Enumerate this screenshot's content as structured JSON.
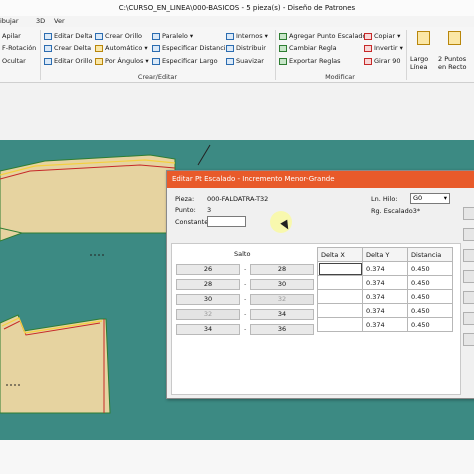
{
  "window": {
    "title": "C:\\CURSO_EN_LINEA\\000-BASICOS  -  5 pieza(s)  -  Diseño de Patrones"
  },
  "menu": {
    "items": [
      "ibujar",
      "3D",
      "Ver"
    ]
  },
  "ribbon": {
    "col1": [
      "Apilar",
      "F-Rotación",
      "Ocultar"
    ],
    "col2": [
      "Editar Delta",
      "Crear Delta",
      "Editar Orillo"
    ],
    "col3": [
      "Crear Orillo",
      "Automático",
      "Por Ángulos"
    ],
    "col4": [
      "Paralelo",
      "Especificar Distancia",
      "Especificar Largo"
    ],
    "col5": [
      "Internos",
      "Distribuir",
      "Suavizar"
    ],
    "col6": [
      "Agregar Punto Escalado",
      "Cambiar Regla",
      "Exportar Reglas"
    ],
    "col7": [
      "Copiar",
      "Invertir",
      "Girar 90"
    ],
    "big1": [
      "Largo",
      "Línea"
    ],
    "big2": [
      "2 Puntos",
      "en Recto"
    ],
    "groups": [
      "Crear/Editar",
      "Modificar"
    ]
  },
  "dialog": {
    "title": "Editar Pt Escalado - Incremento Menor-Grande",
    "pieza_label": "Pieza:",
    "pieza_value": "000-FALDATRA-T32",
    "punto_label": "Punto:",
    "punto_value": "3",
    "constante_label": "Constante:",
    "constante_value": "",
    "lnhilo_label": "Ln. Hilo:",
    "lnhilo_value": "G0",
    "rg_label": "Rg. Escalado3*",
    "salto_label": "Salto",
    "steps": [
      {
        "from": "26",
        "to": "28",
        "from_enabled": true,
        "to_enabled": true
      },
      {
        "from": "28",
        "to": "30",
        "from_enabled": true,
        "to_enabled": true
      },
      {
        "from": "30",
        "to": "32",
        "from_enabled": true,
        "to_enabled": false
      },
      {
        "from": "32",
        "to": "34",
        "from_enabled": false,
        "to_enabled": true
      },
      {
        "from": "34",
        "to": "36",
        "from_enabled": true,
        "to_enabled": true
      }
    ],
    "dash": "-",
    "table_headers": [
      "Delta X",
      "Delta Y",
      "Distancia"
    ],
    "table_rows": [
      [
        "",
        "0.374",
        "0.450"
      ],
      [
        "",
        "0.374",
        "0.450"
      ],
      [
        "",
        "0.374",
        "0.450"
      ],
      [
        "",
        "0.374",
        "0.450"
      ],
      [
        "",
        "0.374",
        "0.450"
      ]
    ]
  },
  "colors": {
    "canvas": "#3c8a83",
    "title_bar": "#e85a2a",
    "pattern": "#e6d3a0"
  }
}
